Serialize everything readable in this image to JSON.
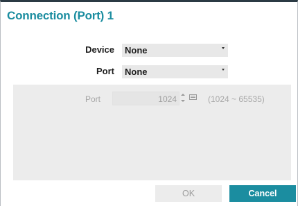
{
  "dialog": {
    "title": "Connection (Port) 1"
  },
  "fields": {
    "device_label": "Device",
    "device_value": "None",
    "port_label": "Port",
    "port_value": "None"
  },
  "port_panel": {
    "label": "Port",
    "value": "1024",
    "range": "(1024 ~ 65535)",
    "spinner_icon": "spinner-updown-icon",
    "keyboard_icon": "keyboard-icon"
  },
  "buttons": {
    "ok": "OK",
    "cancel": "Cancel"
  },
  "colors": {
    "accent": "#1b8da0",
    "header_bar": "#2b3a44",
    "panel_bg": "#ececec",
    "disabled_text": "#a7a7a7"
  }
}
